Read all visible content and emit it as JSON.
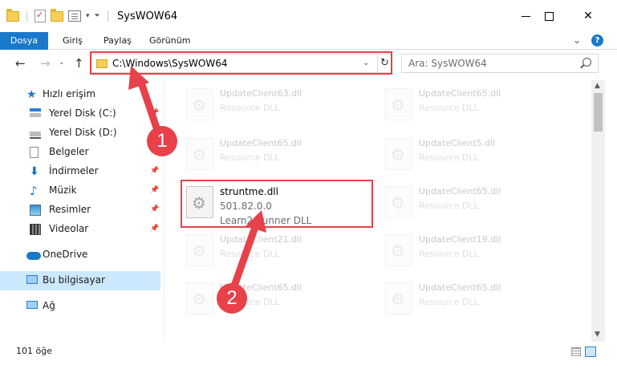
{
  "window": {
    "title": "SysWOW64",
    "minimize_glyph": "",
    "close_glyph": "✕"
  },
  "ribbon": {
    "tabs": [
      "Dosya",
      "Giriş",
      "Paylaş",
      "Görünüm"
    ],
    "help": "?"
  },
  "address": {
    "path": "C:\\Windows\\SysWOW64",
    "search_placeholder": "Ara: SysWOW64"
  },
  "sidebar": {
    "items": [
      {
        "label": "Hızlı erişim",
        "icon": "star-icon",
        "pinned": false
      },
      {
        "label": "Yerel Disk (C:)",
        "icon": "drive-c-icon",
        "pinned": true
      },
      {
        "label": "Yerel Disk (D:)",
        "icon": "drive-d-icon",
        "pinned": true
      },
      {
        "label": "Belgeler",
        "icon": "documents-icon",
        "pinned": true
      },
      {
        "label": "İndirmeler",
        "icon": "downloads-icon",
        "pinned": true
      },
      {
        "label": "Müzik",
        "icon": "music-icon",
        "pinned": true
      },
      {
        "label": "Resimler",
        "icon": "pictures-icon",
        "pinned": true
      },
      {
        "label": "Videolar",
        "icon": "videos-icon",
        "pinned": true
      },
      {
        "label": "OneDrive",
        "icon": "onedrive-icon",
        "pinned": false
      },
      {
        "label": "Bu bilgisayar",
        "icon": "this-pc-icon",
        "pinned": false,
        "selected": true
      },
      {
        "label": "Ağ",
        "icon": "network-icon",
        "pinned": false
      }
    ]
  },
  "files": {
    "faded": [
      {
        "name": "UpdateClient63.dll",
        "type": "Resource DLL"
      },
      {
        "name": "UpdateClient65.dll",
        "type": "Resource DLL"
      },
      {
        "name": "UpdateClient65.dll",
        "type": "Resource DLL"
      },
      {
        "name": "UpdateClient5.dll",
        "type": "Resource DLL"
      },
      {
        "name": "UpdateClient65.dll",
        "type": "Resource DLL"
      },
      {
        "name": "UpdateClient21.dll",
        "type": "Resource DLL"
      },
      {
        "name": "UpdateClient19.dll",
        "type": "Resource DLL"
      },
      {
        "name": "UpdateClient65.dll",
        "type": "Resource DLL"
      },
      {
        "name": "UpdateClient65.dll",
        "type": "Resource DLL"
      }
    ],
    "highlighted": {
      "name": "struntme.dll",
      "version": "501.82.0.0",
      "description": "Learn2 Runner DLL"
    }
  },
  "status": {
    "item_count": "101 öğe"
  },
  "annotations": {
    "step1": "1",
    "step2": "2",
    "color": "#e8414a"
  }
}
